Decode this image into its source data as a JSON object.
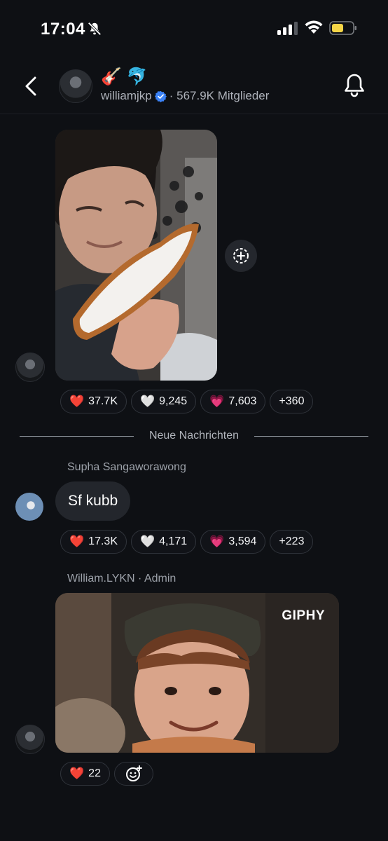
{
  "status_bar": {
    "time": "17:04"
  },
  "header": {
    "emojis": "🎸 🐬",
    "channel_name": "williamjkp",
    "members": "· 567.9K Mitglieder"
  },
  "post1": {
    "reactions": [
      {
        "emoji": "❤️",
        "count": "37.7K"
      },
      {
        "emoji": "🤍",
        "count": "9,245"
      },
      {
        "emoji": "💗",
        "count": "7,603"
      },
      {
        "emoji": "",
        "count": "+360"
      }
    ]
  },
  "divider": {
    "label": "Neue Nachrichten"
  },
  "post2": {
    "sender": "Supha Sangaworawong",
    "text": "Sf kubb",
    "reactions": [
      {
        "emoji": "❤️",
        "count": "17.3K"
      },
      {
        "emoji": "🤍",
        "count": "4,171"
      },
      {
        "emoji": "💗",
        "count": "3,594"
      },
      {
        "emoji": "",
        "count": "+223"
      }
    ]
  },
  "post3": {
    "sender": "William.LYKN · Admin",
    "gif_label": "GIPHY",
    "reactions": [
      {
        "emoji": "❤️",
        "count": "22"
      }
    ]
  },
  "colors": {
    "accent_verified": "#3b82f6",
    "background": "#0e1014",
    "battery": "#f5d547"
  }
}
